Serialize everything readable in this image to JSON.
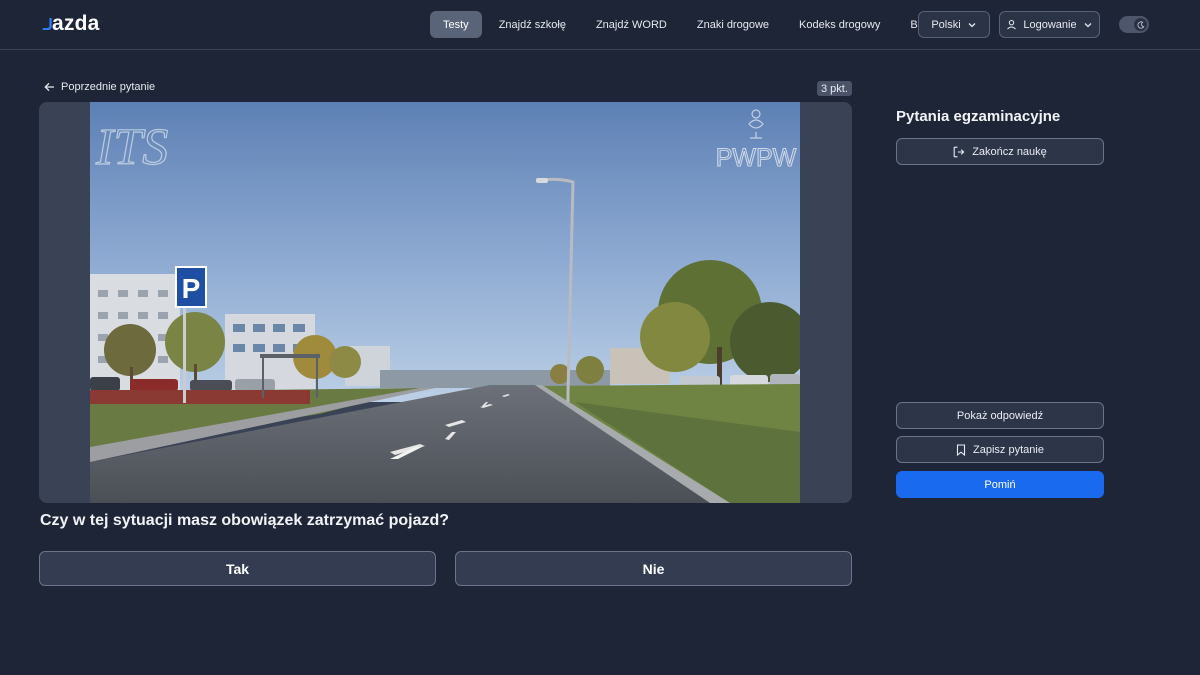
{
  "header": {
    "logo_text": "azda",
    "nav": [
      {
        "label": "Testy",
        "active": true
      },
      {
        "label": "Znajdź szkołę",
        "active": false
      },
      {
        "label": "Znajdź WORD",
        "active": false
      },
      {
        "label": "Znaki drogowe",
        "active": false
      },
      {
        "label": "Kodeks drogowy",
        "active": false
      },
      {
        "label": "Blog",
        "active": false
      }
    ],
    "language_label": "Polski",
    "login_label": "Logowanie",
    "theme_toggle_icon": "moon-icon"
  },
  "question_area": {
    "back_label": "Poprzednie pytanie",
    "points_label": "3 pkt.",
    "media": {
      "watermark_left": "ITS",
      "watermark_right": "PWPW",
      "parking_sign": "P"
    },
    "question_text": "Czy w tej sytuacji masz obowiązek zatrzymać pojazd?",
    "answers": [
      "Tak",
      "Nie"
    ]
  },
  "sidebar": {
    "title": "Pytania egzaminacyjne",
    "end_label": "Zakończ naukę",
    "show_answer_label": "Pokaż odpowiedź",
    "save_label": "Zapisz pytanie",
    "skip_label": "Pomiń"
  },
  "colors": {
    "background": "#1e2536",
    "accent": "#1a6af0",
    "active_nav": "#5a6478"
  }
}
